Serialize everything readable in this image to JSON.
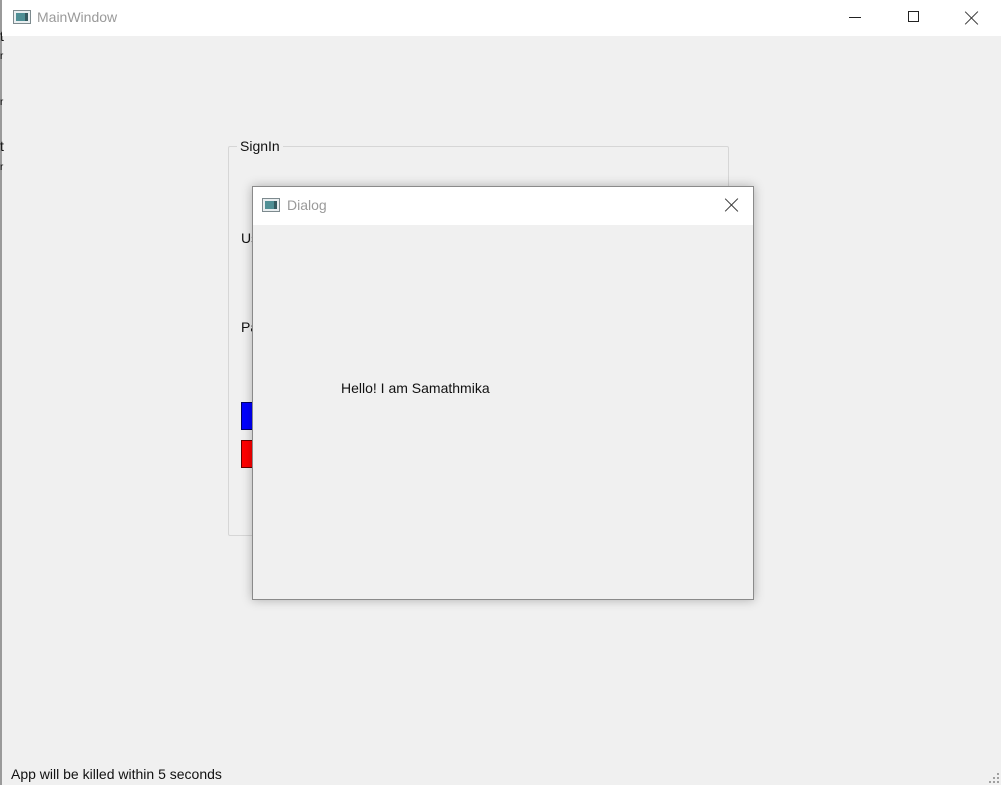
{
  "main_window": {
    "title": "MainWindow"
  },
  "edge_fragments": [
    "t",
    "r",
    "r",
    "t",
    "r"
  ],
  "signin_group": {
    "title": "SignIn",
    "username_label_visible": "Us",
    "password_label_visible": "Pa",
    "signin_button_color": "#0000ff",
    "exit_button_color": "#ff0000"
  },
  "dialog": {
    "title": "Dialog",
    "message": "Hello! I am Samathmika"
  },
  "status_bar": {
    "message": "App will be killed within 5 seconds"
  }
}
